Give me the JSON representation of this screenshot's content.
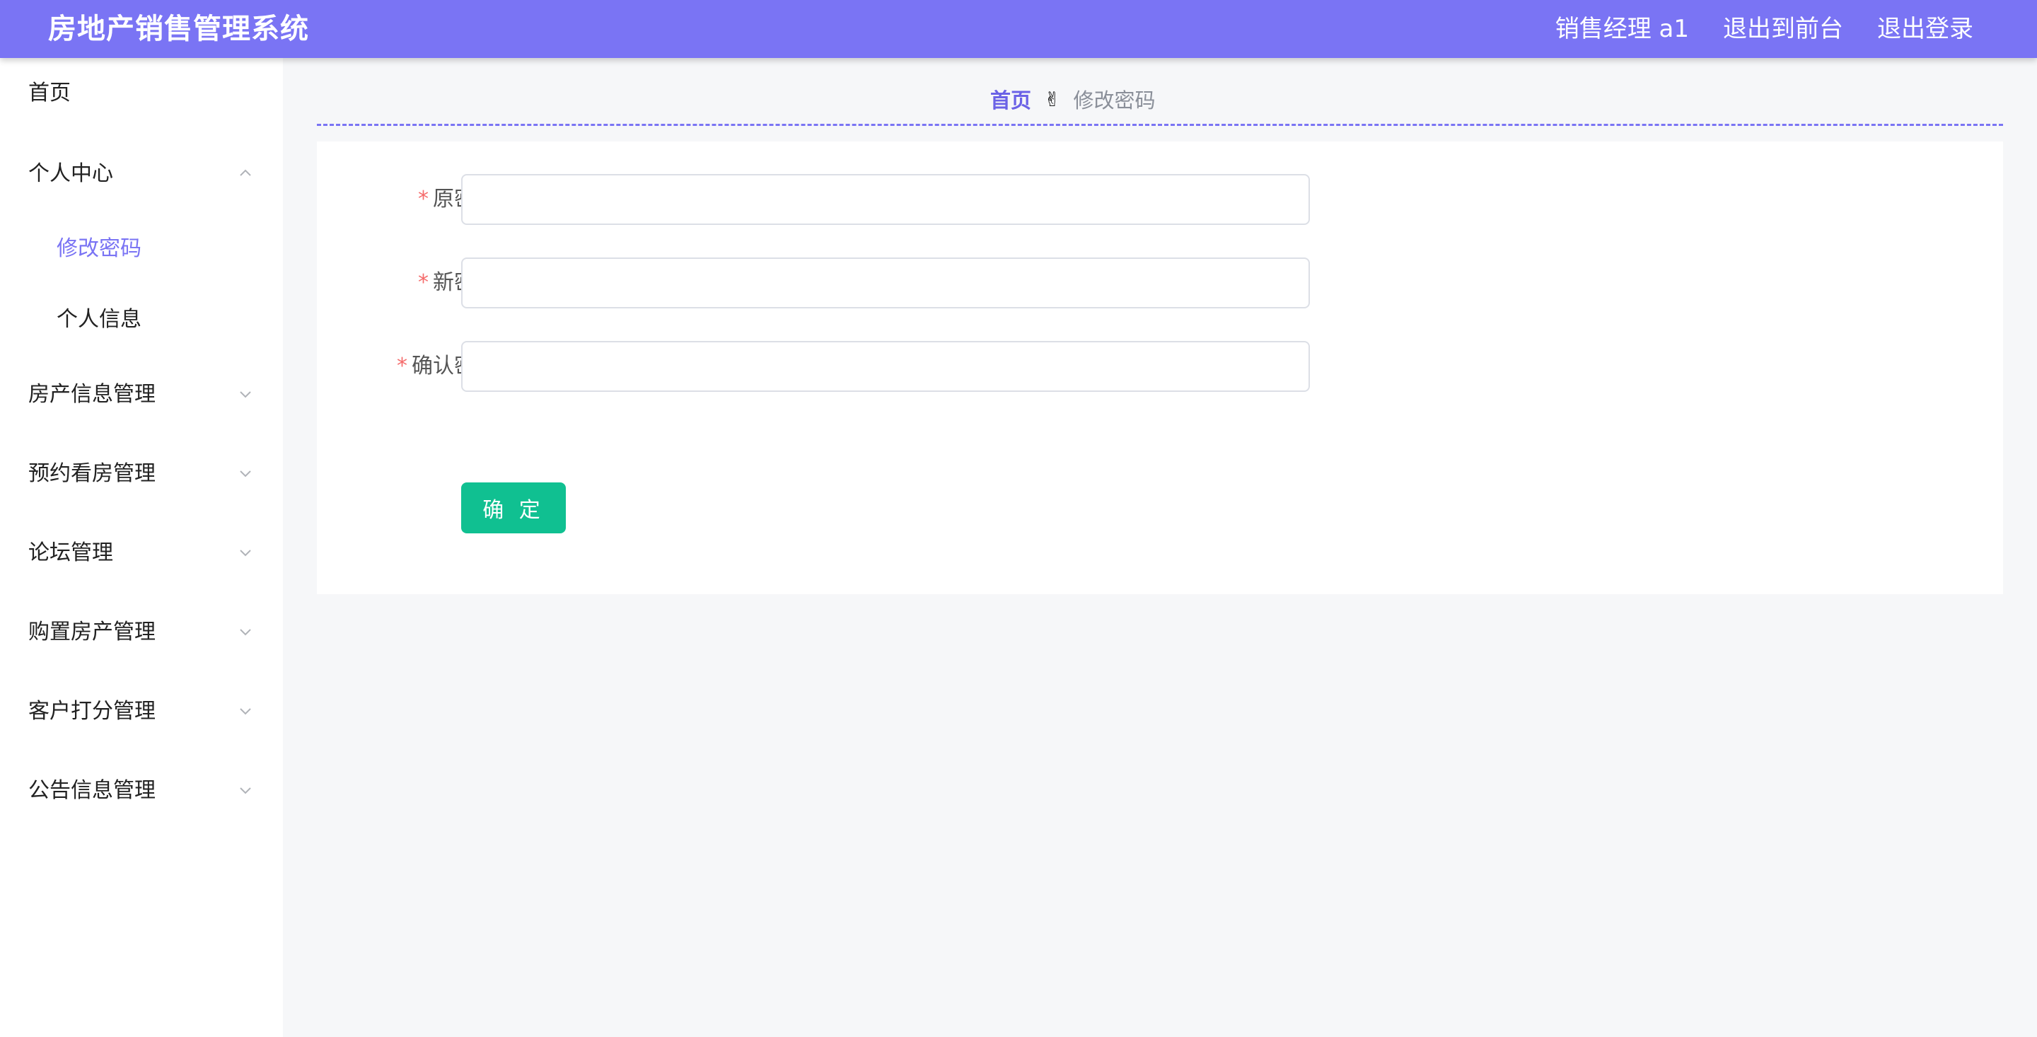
{
  "header": {
    "title": "房地产销售管理系统",
    "user": "销售经理 a1",
    "to_front": "退出到前台",
    "logout": "退出登录"
  },
  "sidebar": {
    "home": "首页",
    "personal": {
      "label": "个人中心",
      "expanded": true,
      "children": [
        "修改密码",
        "个人信息"
      ],
      "active_child": "修改密码"
    },
    "menus": [
      "房产信息管理",
      "预约看房管理",
      "论坛管理",
      "购置房产管理",
      "客户打分管理",
      "公告信息管理"
    ]
  },
  "breadcrumb": {
    "home": "首页",
    "separator_icon": "victory-hand-icon",
    "current": "修改密码"
  },
  "form": {
    "required_mark": "*",
    "old_password_label": "原密码",
    "new_password_label": "新密码",
    "confirm_password_label": "确认密码",
    "old_password_value": "",
    "new_password_value": "",
    "confirm_password_value": "",
    "submit_label": "确 定"
  },
  "colors": {
    "primary": "#7a74f4",
    "submit": "#10c091",
    "required": "#f56c6c",
    "background": "#f6f7f9"
  }
}
